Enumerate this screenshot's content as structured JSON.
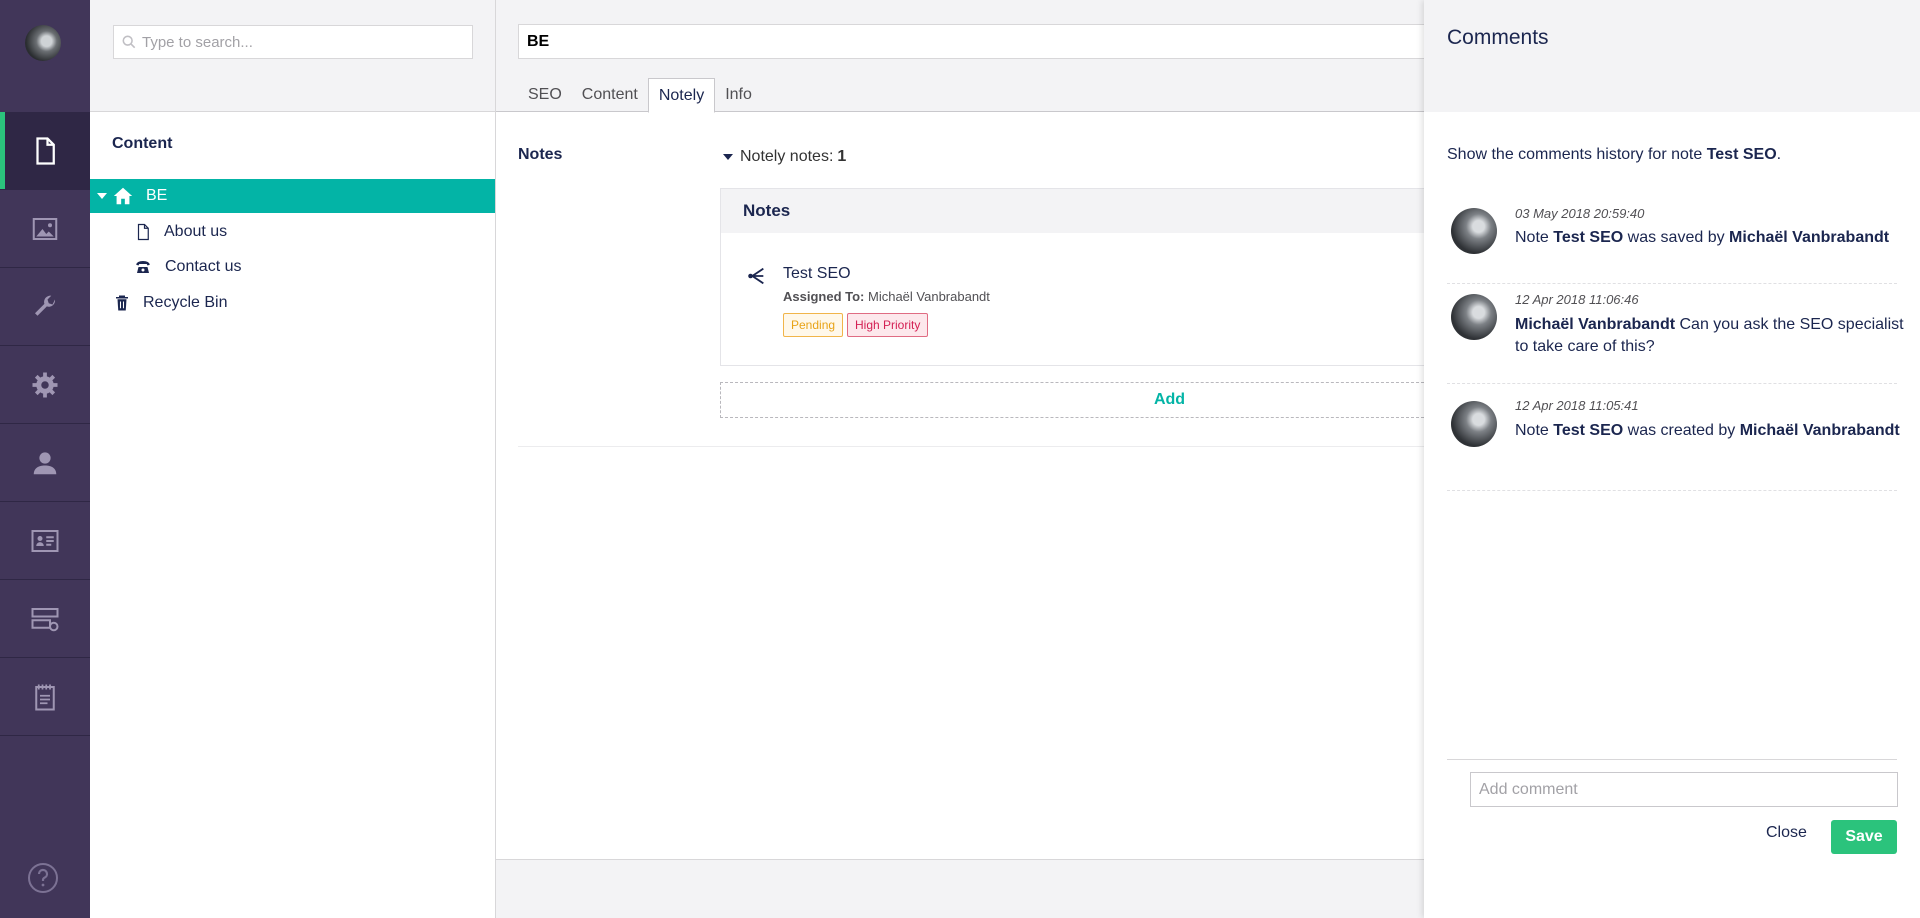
{
  "colors": {
    "sidebar_bg": "#413659",
    "selection": "#03b4a6",
    "accent_green": "#2bc37c",
    "pending": "#e8a317",
    "high_priority": "#d42054"
  },
  "sidebar": {
    "sections": [
      {
        "icon": "content-document-icon",
        "active": true
      },
      {
        "icon": "media-image-icon",
        "active": false
      },
      {
        "icon": "settings-wrench-icon",
        "active": false
      },
      {
        "icon": "developer-gear-icon",
        "active": false
      },
      {
        "icon": "users-person-icon",
        "active": false
      },
      {
        "icon": "members-card-icon",
        "active": false
      },
      {
        "icon": "forms-icon",
        "active": false
      },
      {
        "icon": "notes-clipboard-icon",
        "active": false
      }
    ],
    "help_icon": "help-circle-icon"
  },
  "tree": {
    "search_placeholder": "Type to search...",
    "section_title": "Content",
    "nodes": [
      {
        "label": "BE",
        "icon": "home-icon",
        "selected": true
      },
      {
        "label": "About us",
        "icon": "document-icon"
      },
      {
        "label": "Contact us",
        "icon": "phone-icon"
      },
      {
        "label": "Recycle Bin",
        "icon": "trash-icon"
      }
    ]
  },
  "editor": {
    "name": "BE",
    "tabs": [
      "SEO",
      "Content",
      "Notely",
      "Info"
    ],
    "active_tab": "Notely",
    "property_label": "Notes",
    "notes_toggle_label": "Notely notes:",
    "notes_count": "1",
    "notes_box_title": "Notes",
    "note": {
      "title": "Test SEO",
      "assigned_label": "Assigned To:",
      "assigned_to": "Michaël Vanbrabandt",
      "badges": [
        "Pending",
        "High Priority"
      ]
    },
    "add_label": "Add"
  },
  "comments_panel": {
    "title": "Comments",
    "desc_prefix": "Show the comments history for note",
    "desc_note": "Test SEO",
    "desc_suffix": ".",
    "entries": [
      {
        "date": "03 May 2018 20:59:40",
        "p1": "Note",
        "b1": "Test SEO",
        "p2": "was saved by",
        "b2": "Michaël Vanbrabandt"
      },
      {
        "date": "12 Apr 2018 11:06:46",
        "b1": "Michaël Vanbrabandt",
        "p1": "Can you ask the SEO specialist to take care of this?"
      },
      {
        "date": "12 Apr 2018 11:05:41",
        "p1": "Note",
        "b1": "Test SEO",
        "p2": "was created by",
        "b2": "Michaël Vanbrabandt"
      }
    ],
    "input_placeholder": "Add comment",
    "close_label": "Close",
    "save_label": "Save"
  }
}
